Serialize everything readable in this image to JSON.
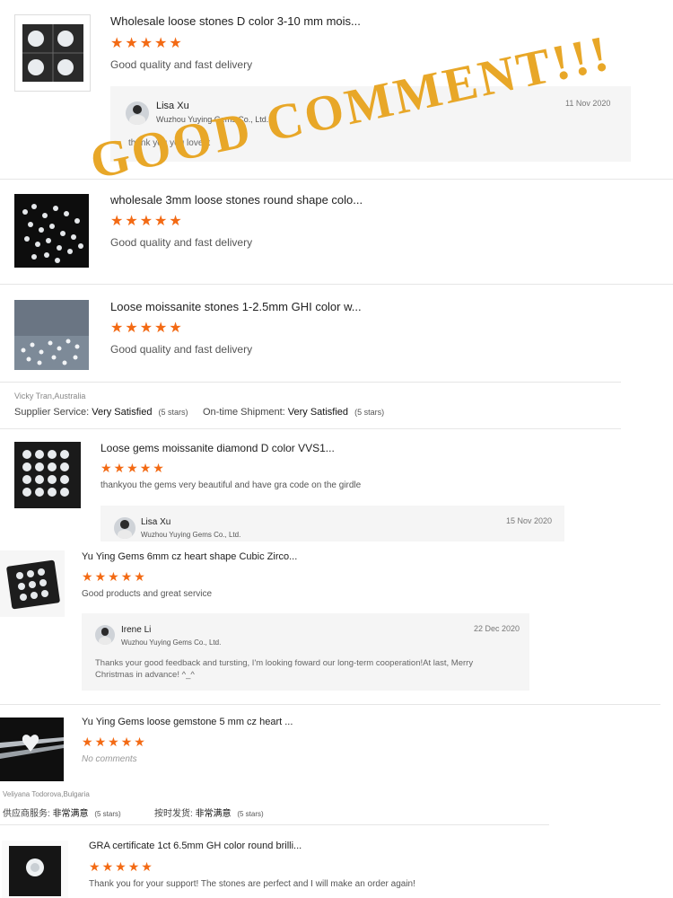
{
  "overlay": {
    "text": "GOOD COMMENT!!!"
  },
  "reviews": [
    {
      "title": "Wholesale loose stones D color 3-10 mm mois...",
      "stars": 5,
      "comment": "Good quality and fast delivery",
      "reply": {
        "name": "Lisa Xu",
        "company": "Wuzhou Yuying Gems Co., Ltd.",
        "date": "11 Nov 2020",
        "text": "thank you you love it"
      }
    },
    {
      "title": "wholesale 3mm loose stones round shape colo...",
      "stars": 5,
      "comment": "Good quality and fast delivery"
    },
    {
      "title": "Loose moissanite stones 1-2.5mm GHI color w...",
      "stars": 5,
      "comment": "Good quality and fast delivery"
    },
    {
      "title": "Loose gems moissanite diamond D color VVS1...",
      "stars": 5,
      "comment": "thankyou the gems very beautiful and have gra code on the girdle",
      "reply": {
        "name": "Lisa Xu",
        "company": "Wuzhou Yuying Gems Co., Ltd.",
        "date": "15 Nov 2020"
      }
    },
    {
      "title": "Yu Ying Gems 6mm cz heart shape Cubic Zirco...",
      "stars": 5,
      "comment": "Good products and great service",
      "reply": {
        "name": "Irene Li",
        "company": "Wuzhou Yuying Gems Co., Ltd.",
        "date": "22 Dec 2020",
        "text": "Thanks your good feedback and tursting, I'm looking foward our long-term cooperation!At last, Merry Christmas in advance! ^_^"
      }
    },
    {
      "title": "Yu Ying Gems loose gemstone 5 mm cz heart ...",
      "stars": 5,
      "comment": "No comments"
    },
    {
      "title": "GRA certificate 1ct 6.5mm GH color round brilli...",
      "stars": 5,
      "comment": "Thank you for your support! The stones are perfect and I will make an order again!"
    }
  ],
  "buyers": [
    {
      "name": "Vicky Tran,Australia",
      "supplier_label": "Supplier Service:",
      "supplier_value": "Very Satisfied",
      "supplier_stars": "(5 stars)",
      "shipment_label": "On-time Shipment:",
      "shipment_value": "Very Satisfied",
      "shipment_stars": "(5 stars)"
    },
    {
      "name": "Veliyana Todorova,Bulgaria",
      "supplier_label": "供应商服务:",
      "supplier_value": "非常满意",
      "supplier_stars": "(5 stars)",
      "shipment_label": "按时发货:",
      "shipment_value": "非常满意",
      "shipment_stars": "(5 stars)"
    }
  ],
  "colors": {
    "star": "#f36a14",
    "overlay": "#e8a728"
  }
}
